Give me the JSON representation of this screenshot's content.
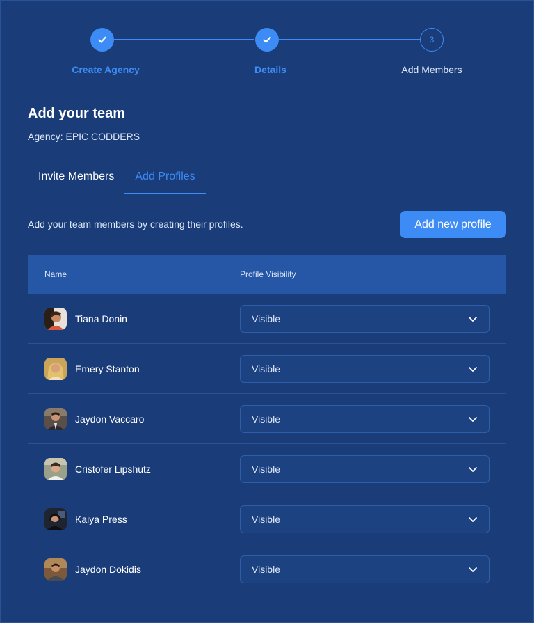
{
  "stepper": {
    "steps": [
      {
        "number": "1",
        "label": "Create Agency",
        "status": "done"
      },
      {
        "number": "2",
        "label": "Details",
        "status": "done"
      },
      {
        "number": "3",
        "label": "Add Members",
        "status": "current"
      }
    ]
  },
  "header": {
    "title": "Add your team",
    "agency": "Agency: EPIC CODDERS"
  },
  "tabs": [
    {
      "label": "Invite Members",
      "active": false
    },
    {
      "label": "Add Profiles",
      "active": true
    }
  ],
  "toolbar": {
    "hint": "Add your team members by creating their profiles.",
    "add_label": "Add new profile"
  },
  "table": {
    "columns": [
      "Name",
      "Profile Visibility"
    ],
    "rows": [
      {
        "name": "Tiana Donin",
        "visibility": "Visible"
      },
      {
        "name": "Emery Stanton",
        "visibility": "Visible"
      },
      {
        "name": "Jaydon Vaccaro",
        "visibility": "Visible"
      },
      {
        "name": "Cristofer Lipshutz",
        "visibility": "Visible"
      },
      {
        "name": "Kaiya Press",
        "visibility": "Visible"
      },
      {
        "name": "Jaydon Dokidis",
        "visibility": "Visible"
      }
    ]
  },
  "colors": {
    "background": "#1a3d7a",
    "accent": "#3d8cf5",
    "header_row": "#2656a6"
  }
}
